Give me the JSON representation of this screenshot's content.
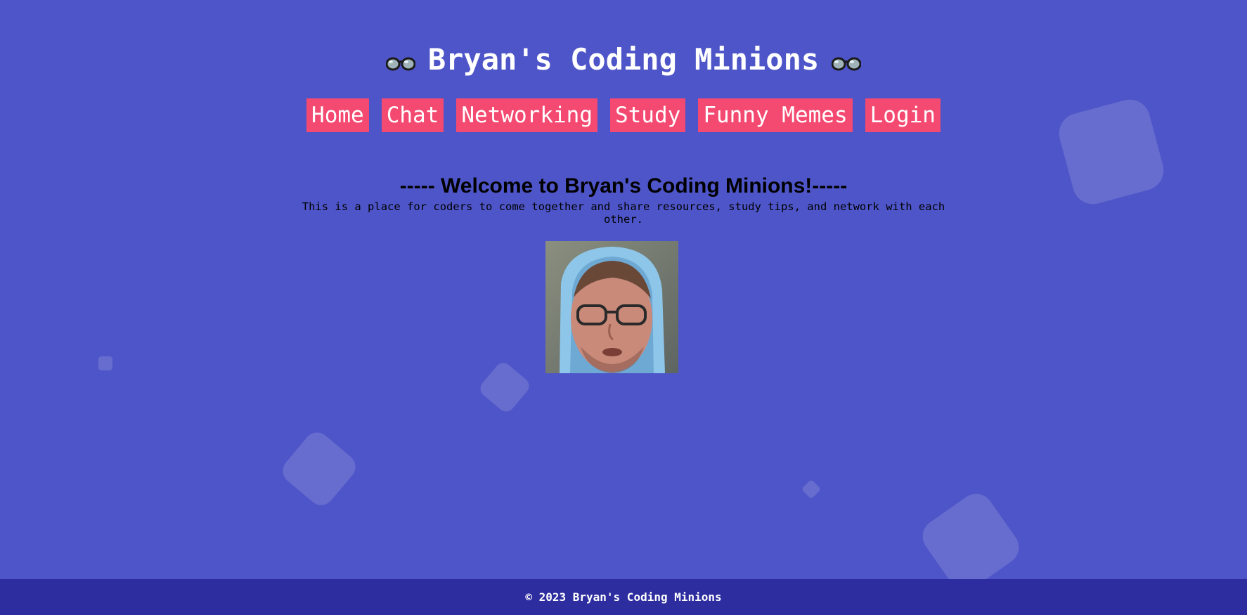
{
  "header": {
    "title": "Bryan's Coding Minions",
    "left_icon": "glasses-icon",
    "right_icon": "glasses-icon"
  },
  "nav": {
    "items": [
      {
        "label": "Home"
      },
      {
        "label": "Chat"
      },
      {
        "label": "Networking"
      },
      {
        "label": "Study"
      },
      {
        "label": "Funny Memes"
      },
      {
        "label": "Login"
      }
    ]
  },
  "welcome": {
    "heading": "----- Welcome to Bryan's Coding Minions!-----",
    "description": "This is a place for coders to come together and share resources, study tips, and network with each other."
  },
  "footer": {
    "text": "© 2023 Bryan's Coding Minions"
  },
  "colors": {
    "background": "#4e55c8",
    "nav_button": "#f44970",
    "footer": "#2d2da0",
    "text_light": "#ffffff"
  }
}
